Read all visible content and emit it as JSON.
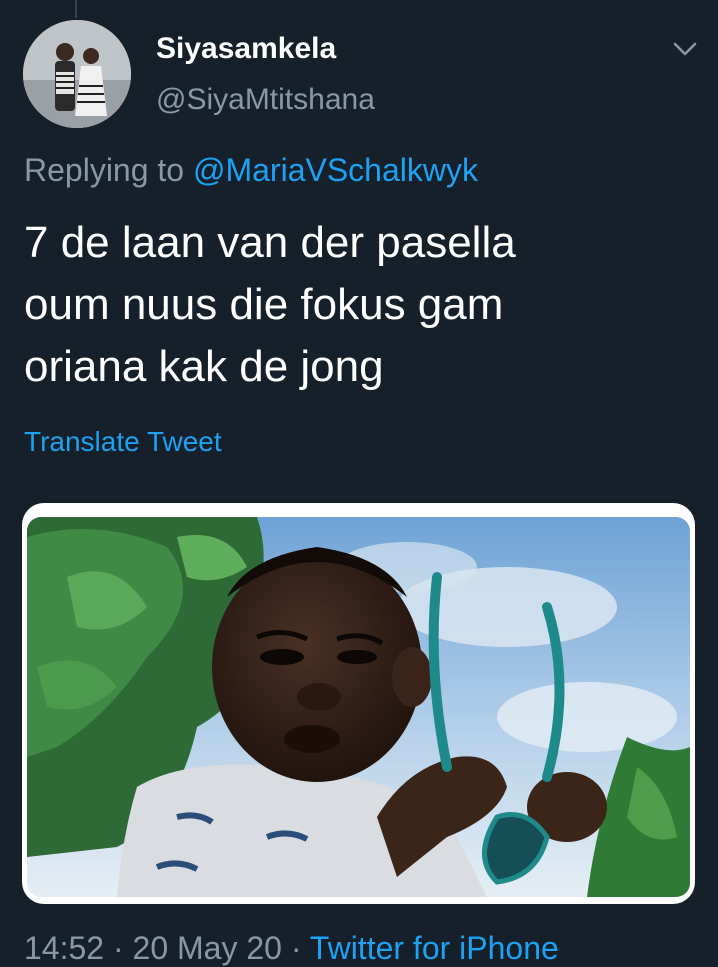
{
  "author": {
    "display_name": "Siyasamkela",
    "handle": "@SiyaMtitshana",
    "avatar_icon": "profile-photo"
  },
  "reply": {
    "prefix": "Replying to",
    "mention": "@MariaVSchalkwyk"
  },
  "tweet": {
    "lines": [
      "7 de laan van der pasella",
      "oum nuus die fokus gam",
      "oriana kak de jong"
    ],
    "translate_label": "Translate Tweet",
    "media_icon": "meme-photo"
  },
  "meta": {
    "time": "14:52",
    "separator_1": " · ",
    "date": "20 May 20",
    "separator_2": " · ",
    "source": "Twitter for iPhone"
  },
  "colors": {
    "background": "#15202b",
    "accent": "#1da1f2",
    "secondary_text": "#8899a6",
    "primary_text": "#ffffff"
  },
  "icons": {
    "more_menu": "chevron-down-icon"
  }
}
